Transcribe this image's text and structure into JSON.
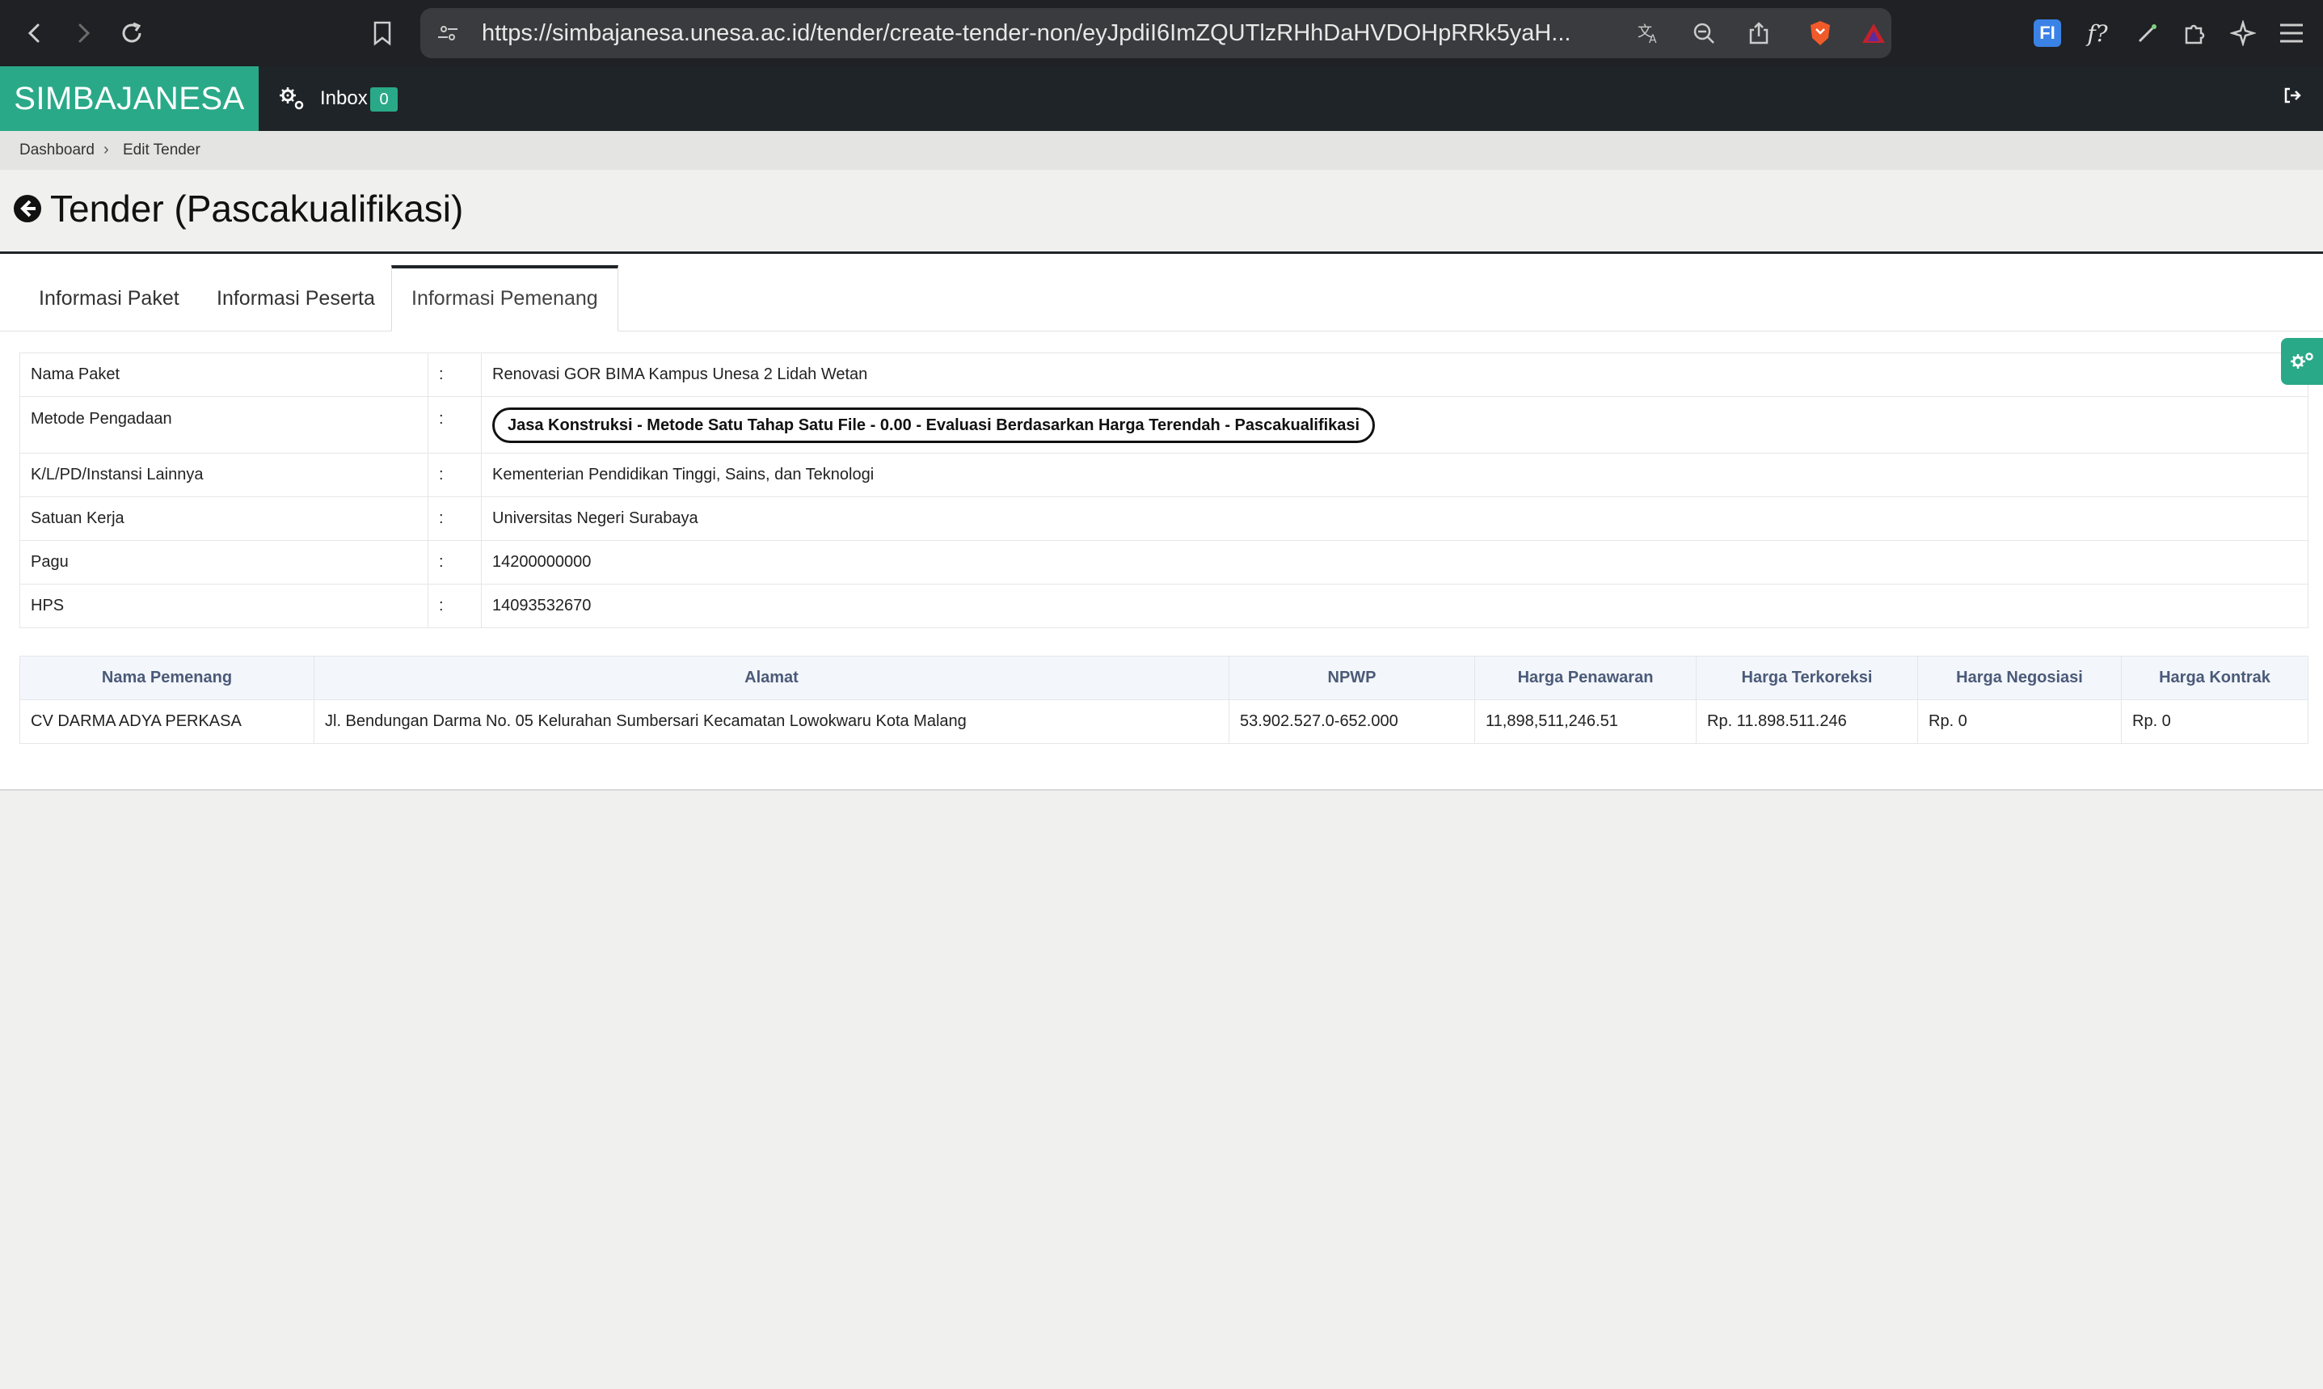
{
  "browser": {
    "url": "https://simbajanesa.unesa.ac.id/tender/create-tender-non/eyJpdiI6ImZQUTlzRHhDaHVDOHpRRk5yaH...",
    "extension_label": "FI",
    "formula_label": "f?"
  },
  "header": {
    "brand": "SIMBAJANESA",
    "inbox_label": "Inbox",
    "inbox_count": "0"
  },
  "breadcrumb": {
    "items": [
      "Dashboard",
      "Edit Tender"
    ],
    "separator": "›"
  },
  "page": {
    "title": "Tender (Pascakualifikasi)"
  },
  "tabs": [
    {
      "label": "Informasi Paket",
      "active": false
    },
    {
      "label": "Informasi Peserta",
      "active": false
    },
    {
      "label": "Informasi Pemenang",
      "active": true
    }
  ],
  "package_info": {
    "separator": ":",
    "rows": [
      {
        "label": "Nama Paket",
        "value": "Renovasi GOR BIMA Kampus Unesa 2 Lidah Wetan"
      },
      {
        "label": "Metode Pengadaan",
        "value": "Jasa Konstruksi - Metode Satu Tahap Satu File - 0.00 - Evaluasi Berdasarkan Harga Terendah - Pascakualifikasi"
      },
      {
        "label": "K/L/PD/Instansi Lainnya",
        "value": "Kementerian Pendidikan Tinggi, Sains, dan Teknologi"
      },
      {
        "label": "Satuan Kerja",
        "value": "Universitas Negeri Surabaya"
      },
      {
        "label": "Pagu",
        "value": "14200000000"
      },
      {
        "label": "HPS",
        "value": "14093532670"
      }
    ]
  },
  "winners": {
    "columns": [
      "Nama Pemenang",
      "Alamat",
      "NPWP",
      "Harga Penawaran",
      "Harga Terkoreksi",
      "Harga Negosiasi",
      "Harga Kontrak"
    ],
    "rows": [
      [
        "CV DARMA ADYA PERKASA",
        "Jl. Bendungan Darma No. 05 Kelurahan Sumbersari Kecamatan Lowokwaru Kota Malang",
        "53.902.527.0-652.000",
        "11,898,511,246.51",
        "Rp. 11.898.511.246",
        "Rp. 0",
        "Rp. 0"
      ]
    ]
  },
  "colors": {
    "brand_green": "#2aa988",
    "header_dark": "#1f2428",
    "browser_chrome": "#202124"
  }
}
